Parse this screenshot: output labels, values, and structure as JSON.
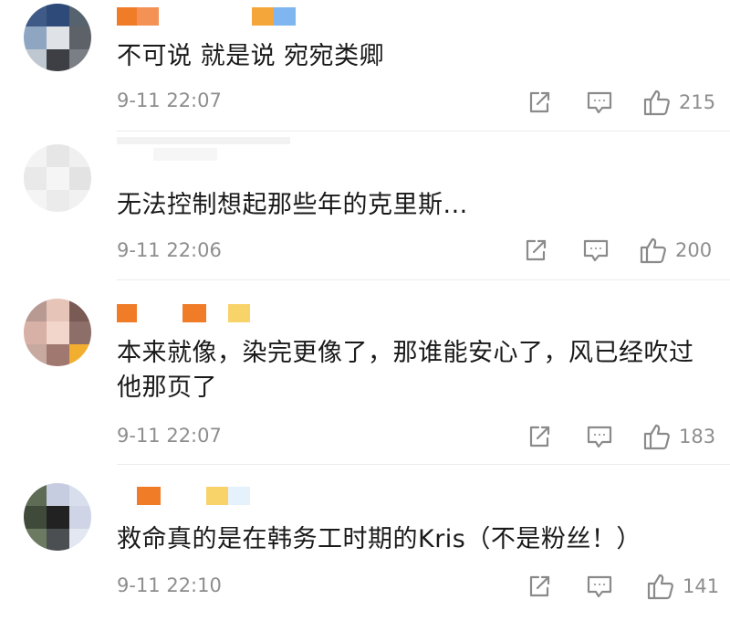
{
  "comments": [
    {
      "text": "不可说 就是说 宛宛类卿",
      "time": "9-11 22:07",
      "likes": "215"
    },
    {
      "text": "无法控制想起那些年的克里斯...",
      "time": "9-11 22:06",
      "likes": "200"
    },
    {
      "text": "本来就像，染完更像了，那谁能安心了，风已经吹过他那页了",
      "time": "9-11 22:07",
      "likes": "183"
    },
    {
      "text": "救命真的是在韩务工时期的Kris（不是粉丝！）",
      "time": "9-11 22:10",
      "likes": "141"
    }
  ],
  "icons": {
    "forward": "forward-icon",
    "reply": "reply-icon",
    "like": "thumbs-up-icon"
  },
  "colors": {
    "text": "#1a1a1a",
    "meta": "#8e8e8e",
    "icon": "#8a8a8a",
    "divider": "#ececec"
  }
}
